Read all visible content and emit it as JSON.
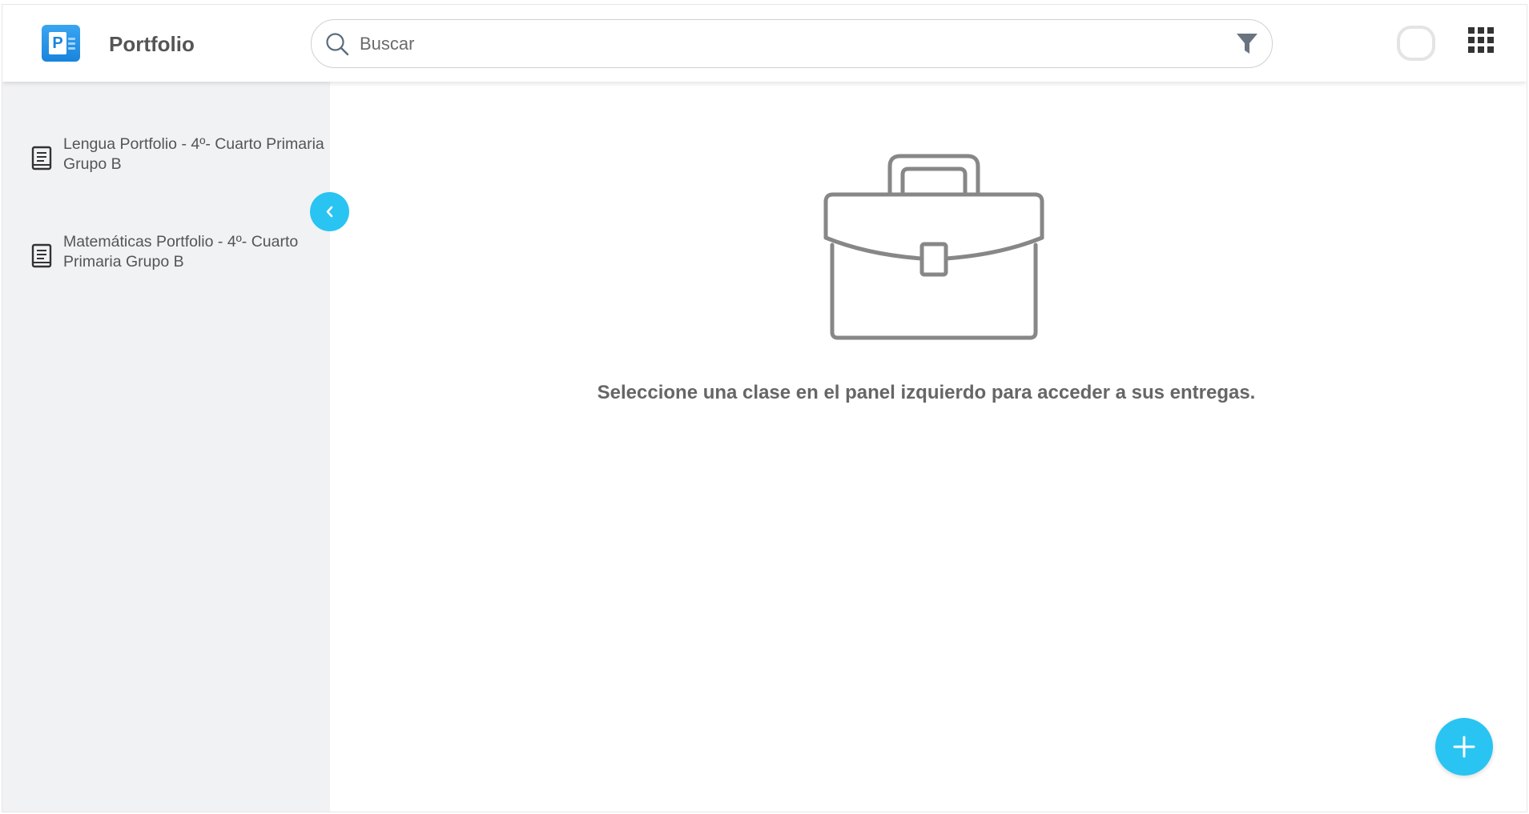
{
  "header": {
    "logo_letter": "P",
    "title": "Portfolio",
    "search_placeholder": "Buscar",
    "search_icon": "search-icon",
    "filter_icon": "filter-icon",
    "apps_icon": "apps-grid-icon"
  },
  "sidebar": {
    "items": [
      {
        "label": "Lengua Portfolio - 4º- Cuarto Primaria Grupo B",
        "icon": "book-icon"
      },
      {
        "label": "Matemáticas Portfolio - 4º- Cuarto Primaria Grupo B",
        "icon": "book-icon"
      }
    ],
    "collapse_icon": "chevron-left-icon"
  },
  "main": {
    "empty_icon": "briefcase-icon",
    "empty_message": "Seleccione una clase en el panel izquierdo para acceder a sus entregas.",
    "fab_icon": "plus-icon"
  },
  "colors": {
    "accent": "#29c4f2",
    "logo": "#1a84dd",
    "sidebar_bg": "#f1f2f4",
    "text": "#555555"
  }
}
